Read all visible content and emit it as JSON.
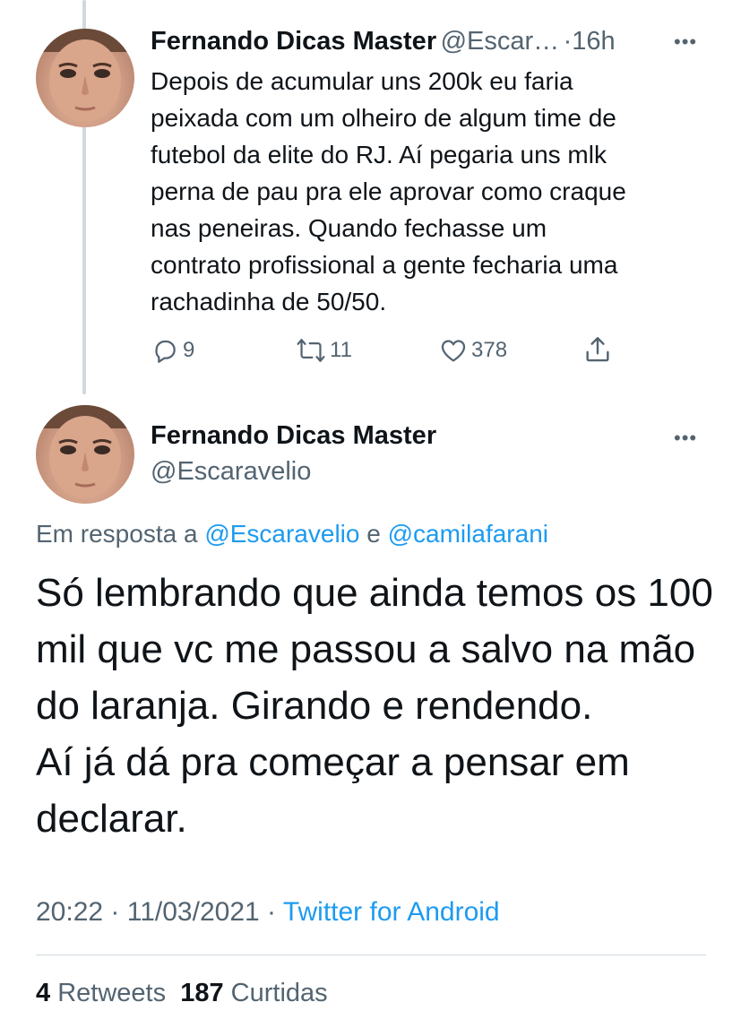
{
  "parent_tweet": {
    "author_name": "Fernando Dicas Master",
    "author_handle": "@Escar…",
    "separator": "·",
    "time_ago": "16h",
    "more": "•••",
    "text": "Depois de acumular uns 200k eu faria\npeixada com um olheiro de algum time de\nfutebol da elite do RJ. Aí pegaria uns mlk\nperna de pau pra ele aprovar como craque\nnas peneiras. Quando fechasse um\ncontrato profissional a gente fecharia uma\nrachadinha de 50/50.",
    "actions": {
      "reply_count": "9",
      "retweet_count": "11",
      "like_count": "378"
    }
  },
  "main_tweet": {
    "author_name": "Fernando Dicas Master",
    "author_handle": "@Escaravelio",
    "more": "•••",
    "reply_prefix": "Em resposta a",
    "reply_user_1": "@Escaravelio",
    "reply_conjunction": "e",
    "reply_user_2": "@camilafarani",
    "text": "Só lembrando que ainda temos os 100\nmil que vc me passou a salvo na mão\ndo laranja. Girando e rendendo.\nAí já dá pra começar a pensar em\ndeclarar.",
    "time": "20:22",
    "date_separator": "·",
    "date": "11/03/2021",
    "source_separator": "·",
    "source": "Twitter for Android",
    "stats": {
      "retweets_count": "4",
      "retweets_label": "Retweets",
      "likes_count": "187",
      "likes_label": "Curtidas"
    }
  },
  "colors": {
    "link": "#1d9bf0",
    "muted": "#536471",
    "text": "#0f1419",
    "divider": "#cfd9de"
  },
  "icons": [
    "reply-icon",
    "retweet-icon",
    "like-icon",
    "share-icon",
    "more-icon"
  ]
}
